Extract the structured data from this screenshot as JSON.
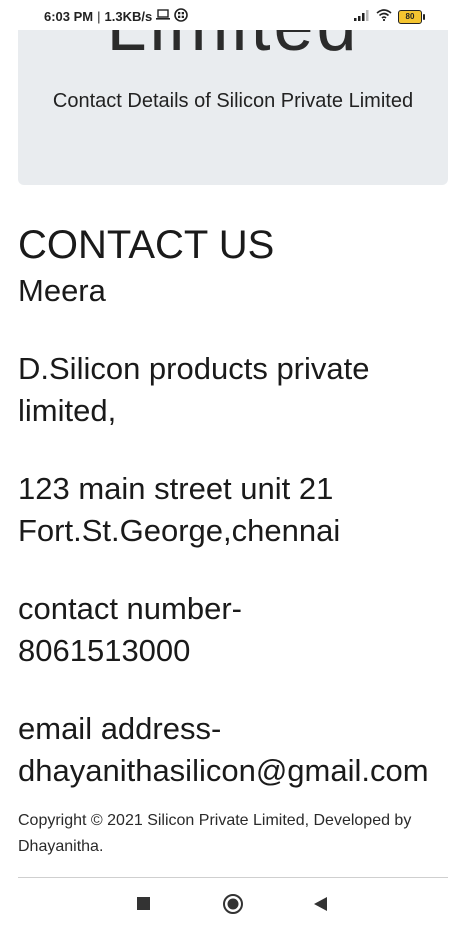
{
  "status_bar": {
    "time": "6:03 PM",
    "separator": "|",
    "speed": "1.3KB/s",
    "battery": "80",
    "icons": [
      "laptop-icon",
      "vpn-icon",
      "signal-icon",
      "wifi-icon",
      "battery-icon"
    ]
  },
  "hero": {
    "display_text": "Limited",
    "lead": "Contact Details of Silicon Private Limited",
    "background": "#e9ecef"
  },
  "contact": {
    "heading": "CONTACT US",
    "name": "Meera",
    "company_line1": "D.Silicon products private",
    "company_line2": "limited,",
    "address_line1": "123 main street unit 21",
    "address_line2": "Fort.St.George,chennai",
    "phone_line1": "contact number-",
    "phone_line2": "8061513000",
    "email_line1": "email address-",
    "email_line2": "dhayanithasilicon@gmail.com"
  },
  "footer": {
    "copyright": "Copyright © 2021 Silicon Private Limited, Developed by Dhayanitha."
  },
  "nav_bar": {
    "buttons": [
      "recents-square-icon",
      "home-circle-icon",
      "back-triangle-icon"
    ]
  }
}
